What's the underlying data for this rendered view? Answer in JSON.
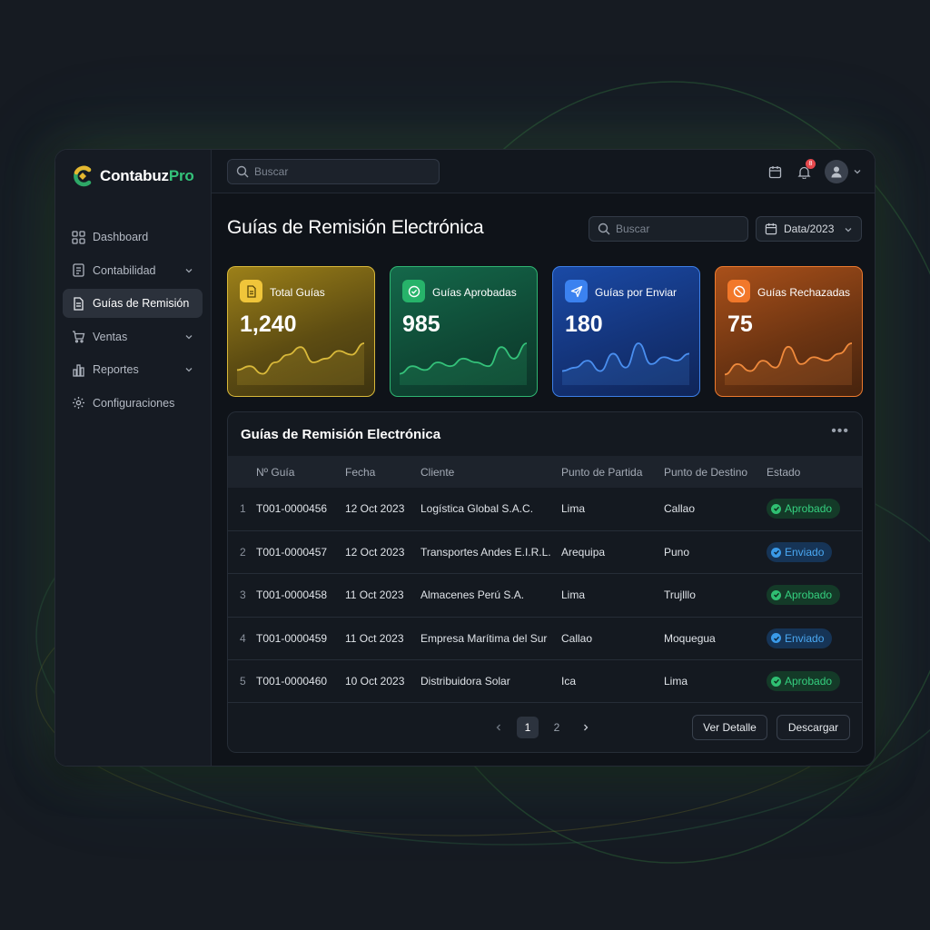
{
  "app": {
    "brand_prefix": "Contabuz",
    "brand_suffix": "Pro"
  },
  "sidebar": {
    "items": [
      {
        "label": "Dashboard",
        "icon": "grid-icon"
      },
      {
        "label": "Contabilidad",
        "icon": "ledger-icon"
      },
      {
        "label": "Guías de Remisión",
        "icon": "document-icon"
      },
      {
        "label": "Ventas",
        "icon": "cart-icon"
      },
      {
        "label": "Reportes",
        "icon": "bar-chart-icon"
      },
      {
        "label": "Configuraciones",
        "icon": "gear-icon"
      }
    ]
  },
  "topbar": {
    "search_placeholder": "Buscar",
    "notification_count": "8"
  },
  "main": {
    "title": "Guías de Remisión Electrónica",
    "search_placeholder": "Buscar",
    "date_filter": "Data/2023"
  },
  "cards": [
    {
      "label": "Total Guías",
      "value": "1,240",
      "color": "#d9b93a",
      "trend": [
        3,
        4,
        2,
        5,
        7,
        9,
        5,
        6,
        8,
        7,
        10
      ]
    },
    {
      "label": "Guías Aprobadas",
      "value": "985",
      "color": "#34c27a",
      "trend": [
        2,
        4,
        3,
        5,
        4,
        6,
        5,
        4,
        9,
        6,
        10
      ]
    },
    {
      "label": "Guías por Enviar",
      "value": "180",
      "color": "#4a8ff0",
      "trend": [
        3,
        4,
        6,
        3,
        8,
        4,
        11,
        5,
        7,
        6,
        8
      ]
    },
    {
      "label": "Guías Rechazadas",
      "value": "75",
      "color": "#f08a3c",
      "trend": [
        2,
        5,
        3,
        6,
        4,
        10,
        5,
        7,
        6,
        8,
        11
      ]
    }
  ],
  "table": {
    "title": "Guías de Remisión Electrónica",
    "headers": [
      "",
      "Nº Guía",
      "Fecha",
      "Cliente",
      "Punto de Partida",
      "Punto de Destino",
      "Estado"
    ],
    "rows": [
      {
        "idx": "1",
        "guia": "T001-0000456",
        "fecha": "12 Oct 2023",
        "cliente": "Logística Global S.A.C.",
        "partida": "Lima",
        "destino": "Callao",
        "estado": "Aprobado"
      },
      {
        "idx": "2",
        "guia": "T001-0000457",
        "fecha": "12 Oct 2023",
        "cliente": "Transportes Andes E.I.R.L.",
        "partida": "Arequipa",
        "destino": "Puno",
        "estado": "Enviado"
      },
      {
        "idx": "3",
        "guia": "T001-0000458",
        "fecha": "11 Oct 2023",
        "cliente": "Almacenes Perú S.A.",
        "partida": "Lima",
        "destino": "Trujlllo",
        "estado": "Aprobado"
      },
      {
        "idx": "4",
        "guia": "T001-0000459",
        "fecha": "11 Oct 2023",
        "cliente": "Empresa Marítima del Sur",
        "partida": "Callao",
        "destino": "Moquegua",
        "estado": "Enviado"
      },
      {
        "idx": "5",
        "guia": "T001-0000460",
        "fecha": "10 Oct 2023",
        "cliente": "Distribuidora Solar",
        "partida": "Ica",
        "destino": "Lima",
        "estado": "Aprobado"
      }
    ],
    "pagination": {
      "pages": [
        "1",
        "2"
      ],
      "current": "1"
    },
    "actions": {
      "detail": "Ver Detalle",
      "download": "Descargar"
    }
  }
}
